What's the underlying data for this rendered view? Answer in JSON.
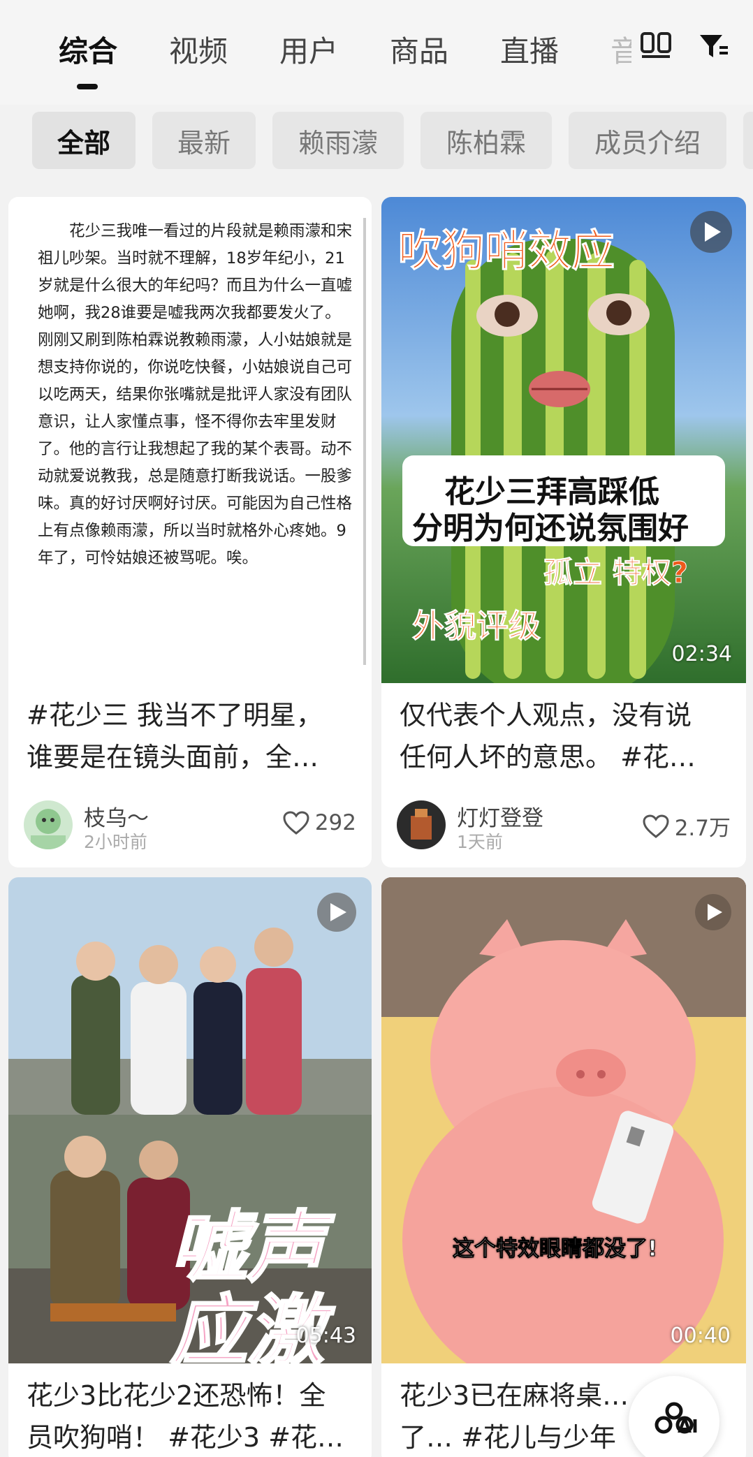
{
  "tabs": {
    "items": [
      "综合",
      "视频",
      "用户",
      "商品",
      "直播",
      "音"
    ],
    "active": "综合"
  },
  "filters": {
    "chips": [
      "全部",
      "最新",
      "赖雨濛",
      "陈柏霖",
      "成员介绍"
    ],
    "active": "全部"
  },
  "icons": {
    "grid": "grid-view-icon",
    "filter": "filter-icon",
    "play": "play-icon",
    "heart": "heart-icon",
    "ai": "ai-assistant-icon"
  },
  "cards": [
    {
      "body_text": "花少三我唯一看过的片段就是赖雨濛和宋祖儿吵架。当时就不理解，18岁年纪小，21岁就是什么很大的年纪吗？而且为什么一直嘘她啊，我28谁要是嘘我两次我都要发火了。刚刚又刷到陈柏霖说教赖雨濛，人小姑娘就是想支持你说的，你说吃快餐，小姑娘说自己可以吃两天，结果你张嘴就是批评人家没有团队意识，让人家懂点事，怪不得你去牢里发财了。他的言行让我想起了我的某个表哥。动不动就爱说教我，总是随意打断我说话。一股爹味。真的好讨厌啊好讨厌。可能因为自己性格上有点像赖雨濛，所以当时就格外心疼她。9年了，可怜姑娘还被骂呢。唉。",
      "title_line1": "#花少三 我当不了明星，",
      "title_line2": "谁要是在镜头面前，全…",
      "author": "枝乌～",
      "time": "2小时前",
      "likes": "292"
    },
    {
      "overlay_top": "吹狗哨效应",
      "overlay_mid1": "花少三拜高踩低",
      "overlay_mid2": "分明为何还说氛围好",
      "overlay_tag1": "孤立 特权?",
      "overlay_tag2": "外貌评级",
      "duration": "02:34",
      "title_line1": "仅代表个人观点，没有说",
      "title_line2": "任何人坏的意思。 #花…",
      "author": "灯灯登登",
      "time": "1天前",
      "likes": "2.7万"
    },
    {
      "overlay_big1": "嘘声",
      "overlay_big2": "应激",
      "duration": "05:43",
      "title_line1": "花少3比花少2还恐怖！全",
      "title_line2": "员吹狗哨！ #花少3 #花…"
    },
    {
      "caption": "这个特效眼睛都没了!",
      "duration": "00:40",
      "title_line1": "花少3已在麻将桌…",
      "title_line2": "了… #花儿与少年"
    }
  ],
  "ai_button": {
    "label": "AI"
  },
  "colors": {
    "active_text": "#111111",
    "chip_bg": "#e6e6e6",
    "overlay_orange": "#e8571a",
    "overlay_pink": "#f5a0bf"
  }
}
